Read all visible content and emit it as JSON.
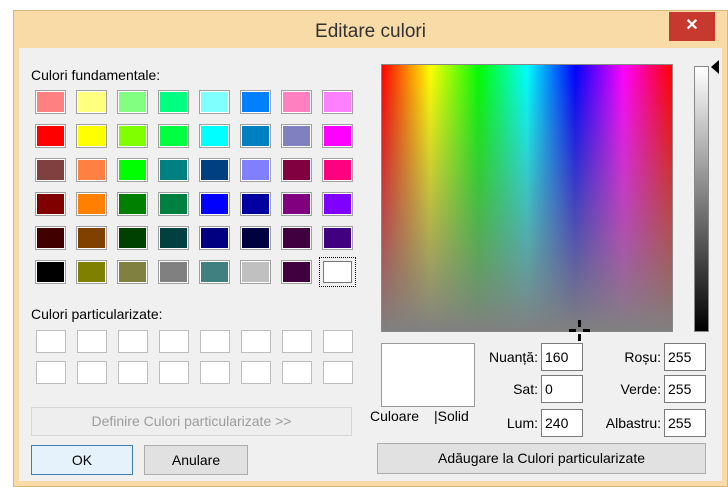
{
  "window": {
    "title": "Editare culori",
    "close_icon": "close-icon",
    "close_glyph": "✕"
  },
  "basic_colors": {
    "label": "Culori fundamentale:",
    "rows": [
      [
        "#ff8080",
        "#ffff80",
        "#80ff80",
        "#00ff80",
        "#80ffff",
        "#0080ff",
        "#ff80c0",
        "#ff80ff"
      ],
      [
        "#ff0000",
        "#ffff00",
        "#80ff00",
        "#00ff40",
        "#00ffff",
        "#0080c0",
        "#8080c0",
        "#ff00ff"
      ],
      [
        "#804040",
        "#ff8040",
        "#00ff00",
        "#008080",
        "#004080",
        "#8080ff",
        "#800040",
        "#ff0080"
      ],
      [
        "#800000",
        "#ff8000",
        "#008000",
        "#008040",
        "#0000ff",
        "#0000a0",
        "#800080",
        "#8000ff"
      ],
      [
        "#400000",
        "#804000",
        "#004000",
        "#004040",
        "#000080",
        "#000040",
        "#400040",
        "#400080"
      ],
      [
        "#000000",
        "#808000",
        "#808040",
        "#808080",
        "#408080",
        "#c0c0c0",
        "#400040",
        "#ffffff"
      ]
    ],
    "selected_index": 47
  },
  "custom_colors": {
    "label": "Culori particularizate:",
    "count": 16
  },
  "buttons": {
    "define_custom": "Definire Culori particularizate >>",
    "ok": "OK",
    "cancel": "Anulare",
    "add_custom": "Adăugare la Culori particularizate"
  },
  "preview": {
    "color_label": "Culoare",
    "solid_label": "|Solid",
    "color": "#ffffff"
  },
  "hsl": {
    "hue_label": "Nuanță:",
    "hue": "160",
    "sat_label": "Sat:",
    "sat": "0",
    "lum_label": "Lum:",
    "lum": "240"
  },
  "rgb": {
    "red_label": "Roșu:",
    "red": "255",
    "green_label": "Verde:",
    "green": "255",
    "blue_label": "Albastru:",
    "blue": "255"
  }
}
